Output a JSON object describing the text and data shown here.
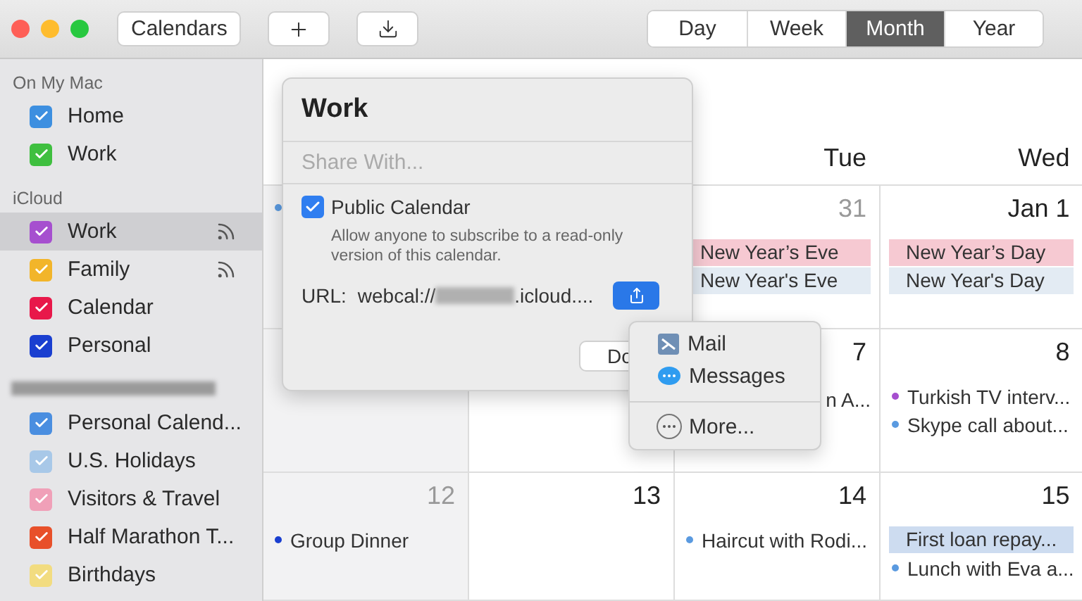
{
  "toolbar": {
    "calendars_button": "Calendars",
    "views": [
      {
        "label": "Day",
        "selected": false
      },
      {
        "label": "Week",
        "selected": false
      },
      {
        "label": "Month",
        "selected": true
      },
      {
        "label": "Year",
        "selected": false
      }
    ]
  },
  "sidebar": {
    "sections": [
      {
        "kind": "titled",
        "title": "On My Mac",
        "items": [
          {
            "name": "Home",
            "color": "#3d8fe0",
            "checked": true,
            "selected": false,
            "shared": false
          },
          {
            "name": "Work",
            "color": "#3fbf3f",
            "checked": true,
            "selected": false,
            "shared": false
          }
        ]
      },
      {
        "kind": "titled",
        "title": "iCloud",
        "items": [
          {
            "name": "Work",
            "color": "#a64fcf",
            "checked": true,
            "selected": true,
            "shared": true
          },
          {
            "name": "Family",
            "color": "#f2b52a",
            "checked": true,
            "selected": false,
            "shared": true
          },
          {
            "name": "Calendar",
            "color": "#e8184a",
            "checked": true,
            "selected": false,
            "shared": false
          },
          {
            "name": "Personal",
            "color": "#1a3fd0",
            "checked": true,
            "selected": false,
            "shared": false
          }
        ]
      },
      {
        "kind": "redacted",
        "items": [
          {
            "name": "Personal Calend...",
            "color": "#4a8ee0",
            "checked": true,
            "selected": false,
            "shared": false
          },
          {
            "name": "U.S. Holidays",
            "color": "#a8c8e8",
            "checked": true,
            "selected": false,
            "shared": false
          },
          {
            "name": "Visitors & Travel",
            "color": "#f0a0b8",
            "checked": true,
            "selected": false,
            "shared": false
          },
          {
            "name": "Half Marathon T...",
            "color": "#e8502a",
            "checked": true,
            "selected": false,
            "shared": false
          },
          {
            "name": "Birthdays",
            "color": "#f2dc80",
            "checked": true,
            "selected": false,
            "shared": false
          }
        ]
      }
    ]
  },
  "calendar": {
    "headers": [
      "Tue",
      "Wed"
    ],
    "weeks": [
      [
        {
          "kind": "day",
          "shaded": true,
          "events": [
            {
              "kind": "timed",
              "color": "#5a9ae0"
            }
          ]
        },
        {
          "kind": "covered"
        },
        {
          "kind": "day",
          "shaded": false,
          "date": "31",
          "dimmed": true,
          "events": [
            {
              "kind": "allday",
              "title": "New Year’s Eve",
              "color": "#f6c9d2"
            },
            {
              "kind": "allday",
              "title": "New Year's Eve",
              "color": "#e3ebf3"
            }
          ]
        },
        {
          "kind": "day",
          "shaded": false,
          "date": "Jan 1",
          "dimmed": false,
          "events": [
            {
              "kind": "allday",
              "title": "New Year’s Day",
              "color": "#f6c9d2"
            },
            {
              "kind": "allday",
              "title": "New Year's Day",
              "color": "#e3ebf3"
            }
          ]
        }
      ],
      [
        {
          "kind": "day",
          "shaded": true
        },
        {
          "kind": "day",
          "shaded": false
        },
        {
          "kind": "day",
          "shaded": false,
          "date": "7",
          "dimmed": false,
          "events": [
            {
              "kind": "partial",
              "title": "n A..."
            }
          ]
        },
        {
          "kind": "day",
          "shaded": false,
          "date": "8",
          "dimmed": false,
          "events": [
            {
              "kind": "timed",
              "title": "Turkish TV interv...",
              "color": "#a64fcf"
            },
            {
              "kind": "timed",
              "title": "Skype call about...",
              "color": "#5a9ae0"
            }
          ]
        }
      ],
      [
        {
          "kind": "day",
          "shaded": true,
          "date": "12",
          "dimmed": true,
          "events": [
            {
              "kind": "timed",
              "title": "Group Dinner",
              "color": "#1a3fd0"
            }
          ]
        },
        {
          "kind": "day",
          "shaded": false,
          "date": "13",
          "dimmed": false
        },
        {
          "kind": "day",
          "shaded": false,
          "date": "14",
          "dimmed": false,
          "events": [
            {
              "kind": "timed",
              "title": "Haircut with Rodi...",
              "color": "#5a9ae0"
            }
          ]
        },
        {
          "kind": "day",
          "shaded": false,
          "date": "15",
          "dimmed": false,
          "events": [
            {
              "kind": "allday",
              "title": "First loan repay...",
              "color": "#cddcf0"
            },
            {
              "kind": "timed",
              "title": "Lunch with Eva a...",
              "color": "#5a9ae0"
            }
          ]
        }
      ]
    ]
  },
  "popover": {
    "title": "Work",
    "share_field": {
      "placeholder": "Share With..."
    },
    "public_calendar": {
      "label": "Public Calendar",
      "checked": true
    },
    "description": "Allow anyone to subscribe to a read-only version of this calendar.",
    "url": {
      "label": "URL:",
      "prefix": "webcal://",
      "suffix": ".icloud...."
    },
    "done_button": "Do"
  },
  "share_menu": {
    "items": [
      {
        "kind": "mail",
        "label": "Mail"
      },
      {
        "kind": "messages",
        "label": "Messages"
      },
      {
        "kind": "more",
        "label": "More..."
      }
    ]
  }
}
